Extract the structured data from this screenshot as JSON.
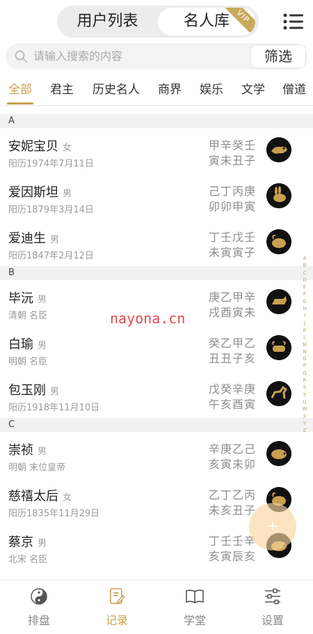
{
  "header": {
    "segments": [
      "用户列表",
      "名人库"
    ],
    "active_segment": "名人库",
    "vip_badge": "VIP",
    "menu_icon": "list-menu-icon"
  },
  "search": {
    "placeholder": "请输入搜索的内容",
    "filter_label": "筛选"
  },
  "tabs": {
    "items": [
      "全部",
      "君主",
      "历史名人",
      "商界",
      "娱乐",
      "文学",
      "僧道"
    ],
    "active": "全部"
  },
  "list": {
    "sections": [
      {
        "letter": "A",
        "people": [
          {
            "name": "安妮宝贝",
            "gender": "女",
            "sub": "阳历1974年7月11日",
            "bazi_top": "甲辛癸壬",
            "bazi_bottom": "寅未丑子",
            "zodiac_icon": "tiger-icon"
          },
          {
            "name": "爱因斯坦",
            "gender": "男",
            "sub": "阳历1879年3月14日",
            "bazi_top": "己丁丙庚",
            "bazi_bottom": "卯卯申寅",
            "zodiac_icon": "rabbit-icon"
          },
          {
            "name": "爱迪生",
            "gender": "男",
            "sub": "阳历1847年2月12日",
            "bazi_top": "丁壬戊壬",
            "bazi_bottom": "未寅寅子",
            "zodiac_icon": "goat-icon"
          }
        ]
      },
      {
        "letter": "B",
        "people": [
          {
            "name": "毕沅",
            "gender": "男",
            "sub": "清朝 名臣",
            "bazi_top": "庚乙甲辛",
            "bazi_bottom": "戌酉寅未",
            "zodiac_icon": "dog-icon"
          },
          {
            "name": "白瑜",
            "gender": "男",
            "sub": "明朝 名臣",
            "bazi_top": "癸乙甲乙",
            "bazi_bottom": "丑丑子亥",
            "zodiac_icon": "ox-icon"
          },
          {
            "name": "包玉刚",
            "gender": "男",
            "sub": "阳历1918年11月10日",
            "bazi_top": "戊癸辛庚",
            "bazi_bottom": "午亥酉寅",
            "zodiac_icon": "horse-icon"
          }
        ]
      },
      {
        "letter": "C",
        "people": [
          {
            "name": "崇祯",
            "gender": "男",
            "sub": "明朝 末位皇帝",
            "bazi_top": "辛庚乙己",
            "bazi_bottom": "亥寅未卯",
            "zodiac_icon": "pig-icon"
          },
          {
            "name": "慈禧太后",
            "gender": "女",
            "sub": "阳历1835年11月29日",
            "bazi_top": "乙丁乙丙",
            "bazi_bottom": "未亥丑子",
            "zodiac_icon": "goat-icon"
          },
          {
            "name": "蔡京",
            "gender": "男",
            "sub": "北宋 名臣",
            "bazi_top": "丁壬壬辛",
            "bazi_bottom": "亥寅辰亥",
            "zodiac_icon": "pig-icon"
          }
        ]
      }
    ]
  },
  "alphabet": [
    "A",
    "B",
    "C",
    "D",
    "E",
    "F",
    "G",
    "H",
    "I",
    "J",
    "K",
    "L",
    "M",
    "N",
    "O",
    "P",
    "Q",
    "R",
    "S",
    "T",
    "U",
    "W",
    "X",
    "Y",
    "Z"
  ],
  "fab": {
    "icon": "plus-icon",
    "label": "+"
  },
  "watermark": "nayona.cn",
  "bottom_nav": {
    "items": [
      {
        "label": "排盘",
        "icon": "yin-yang-icon"
      },
      {
        "label": "记录",
        "icon": "edit-note-icon"
      },
      {
        "label": "学堂",
        "icon": "book-icon"
      },
      {
        "label": "设置",
        "icon": "sliders-icon"
      }
    ],
    "active": "记录"
  },
  "colors": {
    "accent": "#c9a04f",
    "section_bg": "#f1f1f1",
    "fab": "#f7d6a0"
  }
}
